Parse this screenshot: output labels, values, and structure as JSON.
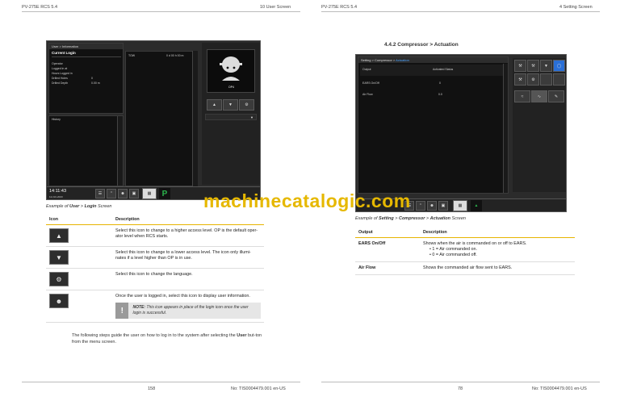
{
  "left_page": {
    "header_left": "PV-275E RCS 5.4",
    "header_right": "10 User Screen",
    "footer_page": "158",
    "footer_doc": "No: TIS0004479.001 en-US",
    "screen": {
      "breadcrumb": "User > Information",
      "panel_title": "Current Login",
      "info_rows": [
        {
          "label": "Operator",
          "value": ""
        },
        {
          "label": "Logged in at",
          "value": ""
        },
        {
          "label": "Hours Logged in",
          "value": ""
        },
        {
          "label": "Drilled Holes",
          "value": "0"
        },
        {
          "label": "Drilled Depth",
          "value": "0.00 m"
        }
      ],
      "tow_label": "TOW",
      "tow_value": "0 d 00 h 00 m",
      "history_title": "History",
      "access_level": "OP4",
      "time": "14:11:43",
      "date": "12-Oct-2023",
      "drive_label": "P"
    },
    "caption_prefix": "Example of ",
    "caption_bold1": "User",
    "caption_sep": " > ",
    "caption_bold2": "Login",
    "caption_suffix": " Screen",
    "table": {
      "col_icon": "Icon",
      "col_desc": "Description",
      "rows": [
        {
          "desc": "Select this icon to change to a higher access level. OP is the default oper-ator level when RCS starts."
        },
        {
          "desc": "Select this icon to change to a lower access level. The icon only illumi-nates if a level higher than OP is in use."
        },
        {
          "desc": "Select this icon to change the language."
        },
        {
          "desc": "Once the user is logged in, select this icon to display user information."
        }
      ],
      "note_bold": "NOTE:",
      "note_text": " This icon appears in place of the login icon once the user login is successful."
    },
    "body_text_pre": "The following steps guide the user on how to log in to the system after selecting the ",
    "body_text_bold": "User",
    "body_text_post": " but-ton from the menu screen."
  },
  "right_page": {
    "header_left": "PV-275E RCS 5.4",
    "header_right": "4 Setting Screen",
    "footer_page": "78",
    "footer_doc": "No: TIS0004479.001 en-US",
    "section_title": "4.4.2 Compressor > Actuation",
    "screen": {
      "breadcrumb_a": "Setting > Compressor > ",
      "breadcrumb_b": "Actuation",
      "col_output": "Output",
      "col_status": "Activated Status",
      "rows": [
        {
          "label": "EARS On/Off",
          "value": "0"
        },
        {
          "label": "Air Flow",
          "value": "0.0"
        }
      ]
    },
    "caption_prefix": "Example of ",
    "caption_b1": "Setting",
    "caption_b2": "Compressor",
    "caption_b3": "Actuation",
    "caption_sep": " > ",
    "caption_suffix": " Screen",
    "table": {
      "col_output": "Output",
      "col_desc": "Description",
      "rows": [
        {
          "output": "EARS On/Off",
          "desc": "Shows when the air is commanded on or off to EARS.",
          "bullets": [
            "1 = Air commanded on.",
            "0 = Air commanded off."
          ]
        },
        {
          "output": "Air Flow",
          "desc": "Shows the commanded air flow sent to EARS.",
          "bullets": []
        }
      ]
    }
  },
  "watermark": "machinecatalogic.com",
  "colors": {
    "accent": "#e7b400",
    "screen_bg": "#2b2b2b",
    "active_blue": "#2a6fd6",
    "green": "#2bb24c"
  }
}
